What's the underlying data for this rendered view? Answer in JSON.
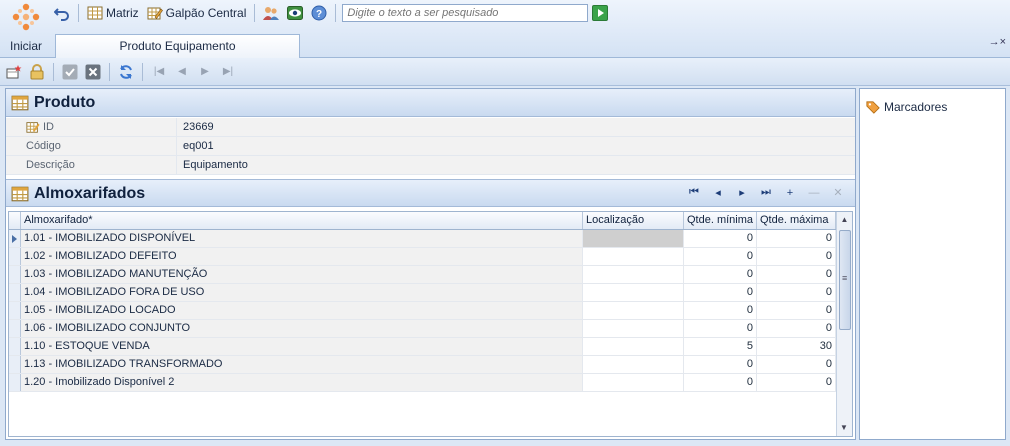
{
  "app": {
    "start_label": "Iniciar"
  },
  "quick_access": {
    "matriz_label": "Matriz",
    "galpao_label": "Galpão Central",
    "search_placeholder": "Digite o texto a ser pesquisado"
  },
  "tab": {
    "label": "Produto Equipamento",
    "pin": "→×"
  },
  "produto": {
    "title": "Produto",
    "fields": [
      {
        "label": "ID",
        "value": "23669"
      },
      {
        "label": "Código",
        "value": "eq001"
      },
      {
        "label": "Descrição",
        "value": "Equipamento"
      }
    ]
  },
  "almox": {
    "title": "Almoxarifados",
    "columns": [
      "Almoxarifado*",
      "Localização",
      "Qtde. mínima",
      "Qtde. máxima"
    ],
    "rows": [
      {
        "name": "1.01 - IMOBILIZADO DISPONÍVEL",
        "loc": "",
        "min": "0",
        "max": "0"
      },
      {
        "name": "1.02 - IMOBILIZADO DEFEITO",
        "loc": "",
        "min": "0",
        "max": "0"
      },
      {
        "name": "1.03 - IMOBILIZADO MANUTENÇÃO",
        "loc": "",
        "min": "0",
        "max": "0"
      },
      {
        "name": "1.04 - IMOBILIZADO FORA DE USO",
        "loc": "",
        "min": "0",
        "max": "0"
      },
      {
        "name": "1.05 - IMOBILIZADO LOCADO",
        "loc": "",
        "min": "0",
        "max": "0"
      },
      {
        "name": "1.06 - IMOBILIZADO CONJUNTO",
        "loc": "",
        "min": "0",
        "max": "0"
      },
      {
        "name": "1.10 - ESTOQUE VENDA",
        "loc": "",
        "min": "5",
        "max": "30"
      },
      {
        "name": "1.13 - IMOBILIZADO TRANSFORMADO",
        "loc": "",
        "min": "0",
        "max": "0"
      },
      {
        "name": "1.20 - Imobilizado Disponível 2",
        "loc": "",
        "min": "0",
        "max": "0"
      }
    ]
  },
  "right_panel": {
    "marcadores_label": "Marcadores"
  },
  "colors": {
    "accent": "#d4e2f4",
    "border": "#8fa9cc"
  }
}
